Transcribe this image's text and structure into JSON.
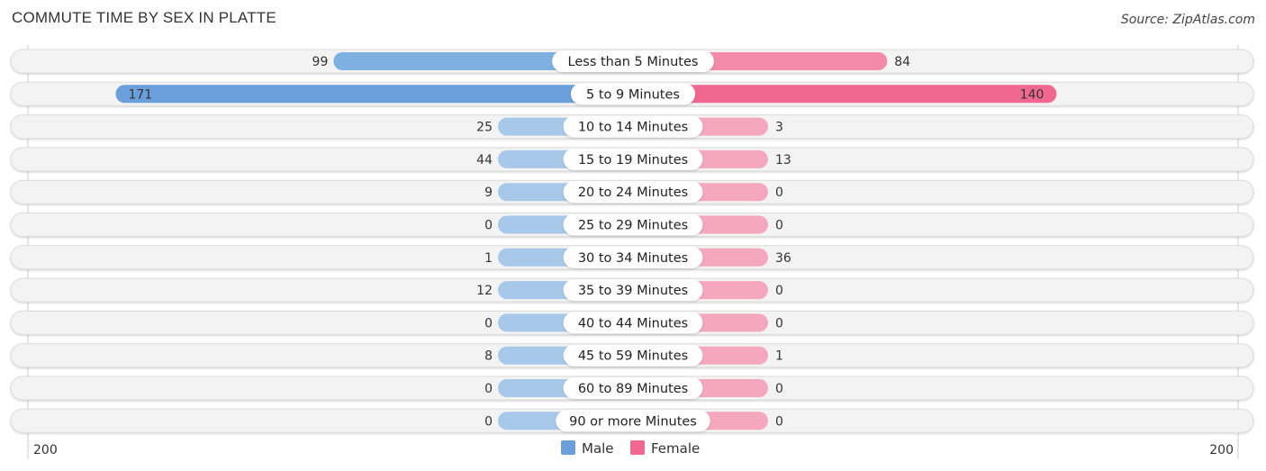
{
  "chart_data": {
    "type": "bar",
    "orientation": "horizontal-diverging",
    "title": "COMMUTE TIME BY SEX IN PLATTE",
    "source": "Source: ZipAtlas.com",
    "categories": [
      "Less than 5 Minutes",
      "5 to 9 Minutes",
      "10 to 14 Minutes",
      "15 to 19 Minutes",
      "20 to 24 Minutes",
      "25 to 29 Minutes",
      "30 to 34 Minutes",
      "35 to 39 Minutes",
      "40 to 44 Minutes",
      "45 to 59 Minutes",
      "60 to 89 Minutes",
      "90 or more Minutes"
    ],
    "series": [
      {
        "name": "Male",
        "color": "#6a9fdc",
        "light_color": "#a8c8ea",
        "values": [
          99,
          171,
          25,
          44,
          9,
          0,
          1,
          12,
          0,
          8,
          0,
          0
        ]
      },
      {
        "name": "Female",
        "color": "#f06890",
        "light_color": "#f5a7bf",
        "values": [
          84,
          140,
          3,
          13,
          0,
          0,
          36,
          0,
          0,
          1,
          0,
          0
        ]
      }
    ],
    "axis": {
      "left_label": "200",
      "right_label": "200",
      "max": 200
    },
    "legend": {
      "position": "bottom-center",
      "items": [
        "Male",
        "Female"
      ]
    }
  }
}
